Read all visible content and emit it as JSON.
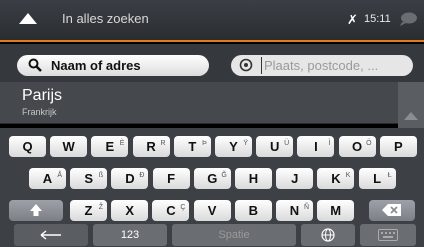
{
  "header": {
    "title": "In alles zoeken",
    "time": "15:11",
    "accent_color": "#e37a1f"
  },
  "search": {
    "name_label": "Naam of adres",
    "place_placeholder": "Plaats, postcode, ...",
    "place_value": ""
  },
  "result": {
    "city": "Parijs",
    "country": "Frankrijk"
  },
  "keyboard": {
    "row1": [
      {
        "label": "Q",
        "sup": ""
      },
      {
        "label": "W",
        "sup": ""
      },
      {
        "label": "E",
        "sup": "È"
      },
      {
        "label": "R",
        "sup": "R"
      },
      {
        "label": "T",
        "sup": "Þ"
      },
      {
        "label": "Y",
        "sup": "Ÿ"
      },
      {
        "label": "U",
        "sup": "Ü"
      },
      {
        "label": "I",
        "sup": "Ì"
      },
      {
        "label": "O",
        "sup": "Ö"
      },
      {
        "label": "P",
        "sup": ""
      }
    ],
    "row2": [
      {
        "label": "A",
        "sup": "Å"
      },
      {
        "label": "S",
        "sup": "ß"
      },
      {
        "label": "D",
        "sup": "Ð"
      },
      {
        "label": "F",
        "sup": ""
      },
      {
        "label": "G",
        "sup": "Ğ"
      },
      {
        "label": "H",
        "sup": ""
      },
      {
        "label": "J",
        "sup": ""
      },
      {
        "label": "K",
        "sup": "K"
      },
      {
        "label": "L",
        "sup": "Ł"
      }
    ],
    "row3": [
      {
        "label": "Z",
        "sup": "Ž"
      },
      {
        "label": "X",
        "sup": ""
      },
      {
        "label": "C",
        "sup": "Ç"
      },
      {
        "label": "V",
        "sup": ""
      },
      {
        "label": "B",
        "sup": ""
      },
      {
        "label": "N",
        "sup": "Ñ"
      },
      {
        "label": "M",
        "sup": ""
      }
    ],
    "numbers_label": "123",
    "space_label": "Spatie"
  }
}
